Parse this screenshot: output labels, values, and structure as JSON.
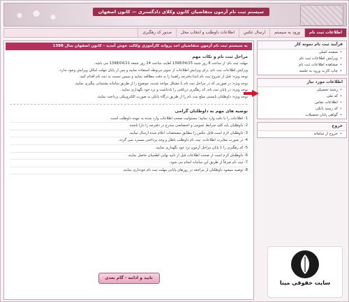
{
  "banner": {
    "title": "سیستم ثبت نام آزمون متقاضیان کانون وکلای دادگستری — کانون اصفهان"
  },
  "menubar": {
    "items": [
      {
        "label": "اطلاعات ثبت نام",
        "active": true
      },
      {
        "label": "ورود به سیستم",
        "active": false
      },
      {
        "label": "ارسال عکس",
        "active": false
      },
      {
        "label": "اطلاعات داوطلب و انتخاب محل",
        "active": false
      },
      {
        "label": "صدور کد رهگیری",
        "active": false
      }
    ]
  },
  "notice": "به سیستم ثبت نام آزمون متقاضیان اخذ پروانه کارآموزی وکالت خوش آمدید - کانون اصفهان سال 1398",
  "main": {
    "section1_title": "مراحل ثبت نام و نکات مهم",
    "p1": "مهلت ثبت نام: از ساعت 8 روز شنبه 1398/04/15 لغایت ساعت 24 روز جمعه 1398/04/21 می باشد.",
    "p2": "ویرایش اطلاعات ثبت نام: برای ویرایش اطلاعات از منوی مربوطه استفاده نمایید و پس از پایان مهلت امکان ویرایش وجود ندارد.",
    "p3": "توجه ویژه: قبل از شروع ثبت نام ابتدا دفترچه راهنما را به دقت مطالعه نمایید و سپس نسبت به ثبت نام اقدام کنید.",
    "p4": "توجه ویژه: در صورتی که در مراحل ثبت نام با مشکل مواجه شدید، موضوع را از طریق سامانه پشتیبانی پیگیری نمایید.",
    "p5": "توجه ویژه: در پایان ثبت نام، کد رهگیری دریافتی را یادداشت و نزد خود نگهداری نمایید.",
    "p6": "توجه ویژه: داوطلبان بایستی مبلغ ثبت نام را از طریق درگاه بانکی به صورت الکترونیکی پرداخت نمایند.",
    "section2_title": "توصیه های مهم به داوطلبان گرامی",
    "rules": [
      "1- اطلاعات را با دقت وارد نمایید؛ مسئولیت صحت اطلاعات وارد شده به عهده داوطلب است.",
      "2- داوطلبان باید کلیه شرایط عمومی و اختصاصی مندرج در دفترچه را دارا باشند.",
      "3- داوطلبان لازم است فایل عکس را مطابق مشخصات اعلام شده ارسال نمایند.",
      "4- در صورت مغایرت اطلاعات، ثبت نام داوطلب باطل و وجه پرداختی مسترد نمی گردد.",
      "5- کد رهگیری را تا پایان مراحل آزمون نزد خود نگهداری نمایید.",
      "6- داوطلبان لازم است از صحت اطلاعات قبل از تایید نهایی اطمینان حاصل نمایند.",
      "7- ثبت نام صرفاً از طریق این سامانه انجام می شود.",
      "8- توصیه میشود داوطلبان از مراجعه در روزهای پایانی مهلت ثبت نام خودداری نمایند."
    ],
    "confirm_button": "تایید و ادامه - گام بعدی"
  },
  "sidebar": {
    "panel1_title": "فرآیند ثبت نام نمونه کار",
    "panel1_items": [
      "صفحه اصلی",
      "ویرایش اطلاعات ثبت نام",
      "مشاهده اطلاعات ثبت نام",
      "چاپ کارت ورود به جلسه"
    ],
    "panel2_title": "اطلاعات مورد نیاز",
    "panel2_items": [
      "رشته تحصیلی",
      "کد ملی",
      "اطلاعات تماس",
      "کد رسید بانکی",
      "گواهی پایان تحصیلات"
    ],
    "panel3_title": "خروج",
    "panel3_items": [
      "خروج از سامانه"
    ]
  },
  "logo": {
    "text": "سایت حقوقی مینا"
  },
  "colors": {
    "accent": "#a32b52",
    "notice_bg": "#b5315c",
    "arrow": "#e0102a"
  }
}
